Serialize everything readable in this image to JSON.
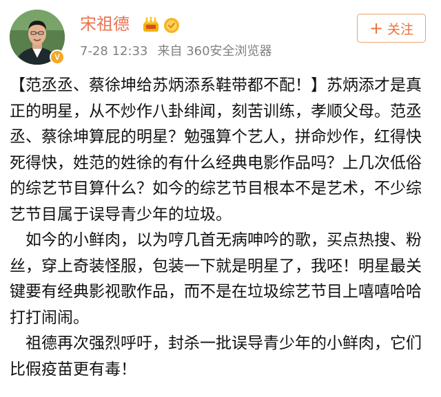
{
  "user": {
    "name": "宋祖德",
    "verified_mark": "V"
  },
  "meta": {
    "date": "7-28",
    "time": "12:33",
    "source": "来自 360安全浏览器"
  },
  "follow_button": {
    "icon": "+",
    "label": "关注"
  },
  "post": {
    "paragraphs": [
      "【范丞丞、蔡徐坤给苏炳添系鞋带都不配！】苏炳添才是真正的明星，从不炒作八卦绯闻，刻苦训练，孝顺父母。范丞丞、蔡徐坤算屁的明星？勉强算个艺人，拼命炒作，红得快死得快，姓范的姓徐的有什么经典电影作品吗？上几次低俗的综艺节目算什么？如今的综艺节目根本不是艺术，不少综艺节目属于误导青少年的垃圾。",
      "　如今的小鲜肉，以为哼几首无病呻吟的歌，买点热搜、粉丝，穿上奇装怪服，包装一下就是明星了，我呸！明星最关键要有经典影视歌作品，而不是在垃圾综艺节目上嘻嘻哈哈打打闹闹。",
      "　祖德再次强烈呼吁，封杀一批误导青少年的小鲜肉，它们比假疫苗更有毒！"
    ]
  },
  "colors": {
    "username": "#eb7350",
    "meta": "#808080",
    "follow_border": "#e8a071",
    "follow_text": "#e8743b",
    "verified_badge": "#f6a623"
  },
  "icons": {
    "crown": "crown-icon",
    "medal": "medal-icon",
    "verified": "verified-icon",
    "plus": "plus-icon"
  }
}
